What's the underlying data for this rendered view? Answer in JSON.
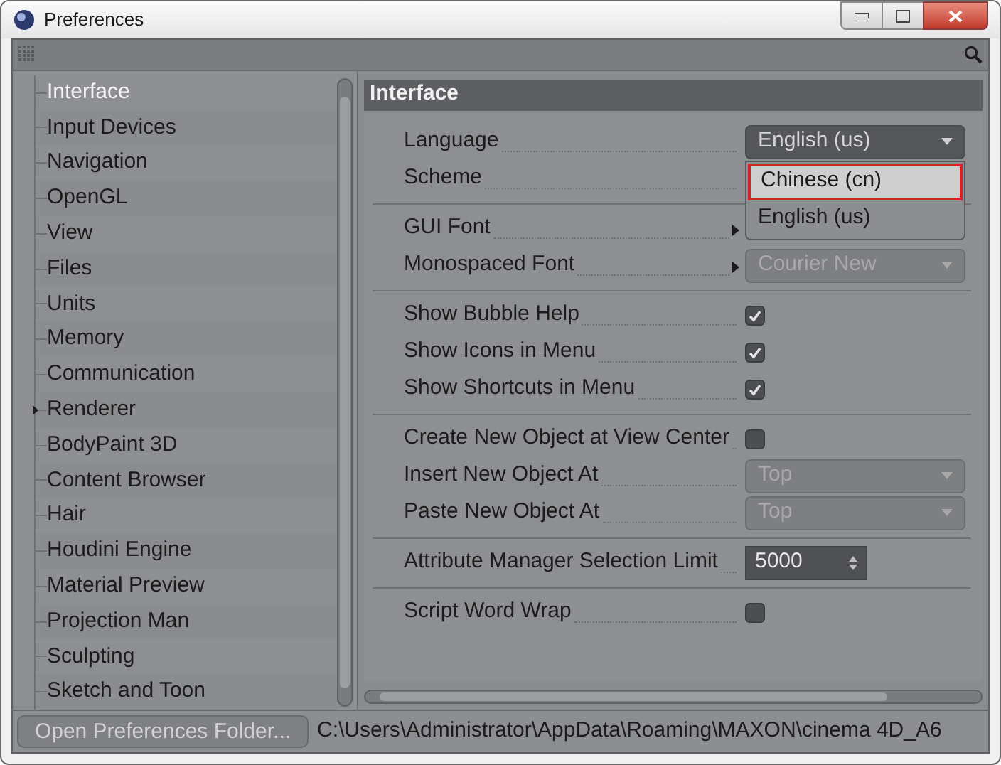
{
  "window": {
    "title": "Preferences"
  },
  "sidebar": {
    "items": [
      {
        "label": "Interface",
        "selected": true,
        "expandable": false
      },
      {
        "label": "Input Devices",
        "selected": false,
        "expandable": false
      },
      {
        "label": "Navigation",
        "selected": false,
        "expandable": false
      },
      {
        "label": "OpenGL",
        "selected": false,
        "expandable": false
      },
      {
        "label": "View",
        "selected": false,
        "expandable": false
      },
      {
        "label": "Files",
        "selected": false,
        "expandable": false
      },
      {
        "label": "Units",
        "selected": false,
        "expandable": false
      },
      {
        "label": "Memory",
        "selected": false,
        "expandable": false
      },
      {
        "label": "Communication",
        "selected": false,
        "expandable": false
      },
      {
        "label": "Renderer",
        "selected": false,
        "expandable": true
      },
      {
        "label": "BodyPaint 3D",
        "selected": false,
        "expandable": false
      },
      {
        "label": "Content Browser",
        "selected": false,
        "expandable": false
      },
      {
        "label": "Hair",
        "selected": false,
        "expandable": false
      },
      {
        "label": "Houdini Engine",
        "selected": false,
        "expandable": false
      },
      {
        "label": "Material Preview",
        "selected": false,
        "expandable": false
      },
      {
        "label": "Projection Man",
        "selected": false,
        "expandable": false
      },
      {
        "label": "Sculpting",
        "selected": false,
        "expandable": false
      },
      {
        "label": "Sketch and Toon",
        "selected": false,
        "expandable": false
      }
    ]
  },
  "panel": {
    "title": "Interface",
    "groups": [
      {
        "rows": [
          {
            "kind": "dropdown",
            "label": "Language",
            "value": "English (us)",
            "disabled": false,
            "arrow": false,
            "menu_open": true
          },
          {
            "kind": "plain",
            "label": "Scheme",
            "arrow": false
          }
        ]
      },
      {
        "rows": [
          {
            "kind": "plain",
            "label": "GUI Font",
            "arrow": true
          },
          {
            "kind": "dropdown",
            "label": "Monospaced Font",
            "value": "Courier New",
            "disabled": true,
            "arrow": true,
            "menu_open": false
          }
        ]
      },
      {
        "rows": [
          {
            "kind": "checkbox",
            "label": "Show Bubble Help",
            "checked": true,
            "arrow": false
          },
          {
            "kind": "checkbox",
            "label": "Show Icons in Menu",
            "checked": true,
            "arrow": false
          },
          {
            "kind": "checkbox",
            "label": "Show Shortcuts in Menu",
            "checked": true,
            "arrow": false
          }
        ]
      },
      {
        "rows": [
          {
            "kind": "checkbox",
            "label": "Create New Object at View Center",
            "checked": false,
            "arrow": false
          },
          {
            "kind": "dropdown",
            "label": "Insert New Object At",
            "value": "Top",
            "disabled": true,
            "arrow": false,
            "menu_open": false
          },
          {
            "kind": "dropdown",
            "label": "Paste New Object At",
            "value": "Top",
            "disabled": true,
            "arrow": false,
            "menu_open": false
          }
        ]
      },
      {
        "rows": [
          {
            "kind": "number",
            "label": "Attribute Manager Selection Limit",
            "value": "5000",
            "arrow": false
          }
        ]
      },
      {
        "rows": [
          {
            "kind": "checkbox",
            "label": "Script Word Wrap",
            "checked": false,
            "arrow": false
          }
        ]
      }
    ]
  },
  "language_menu": {
    "options": [
      {
        "label": "Chinese (cn)",
        "selected": true
      },
      {
        "label": "English (us)",
        "selected": false
      }
    ]
  },
  "footer": {
    "button": "Open Preferences Folder...",
    "path": "C:\\Users\\Administrator\\AppData\\Roaming\\MAXON\\cinema 4D_A6"
  }
}
